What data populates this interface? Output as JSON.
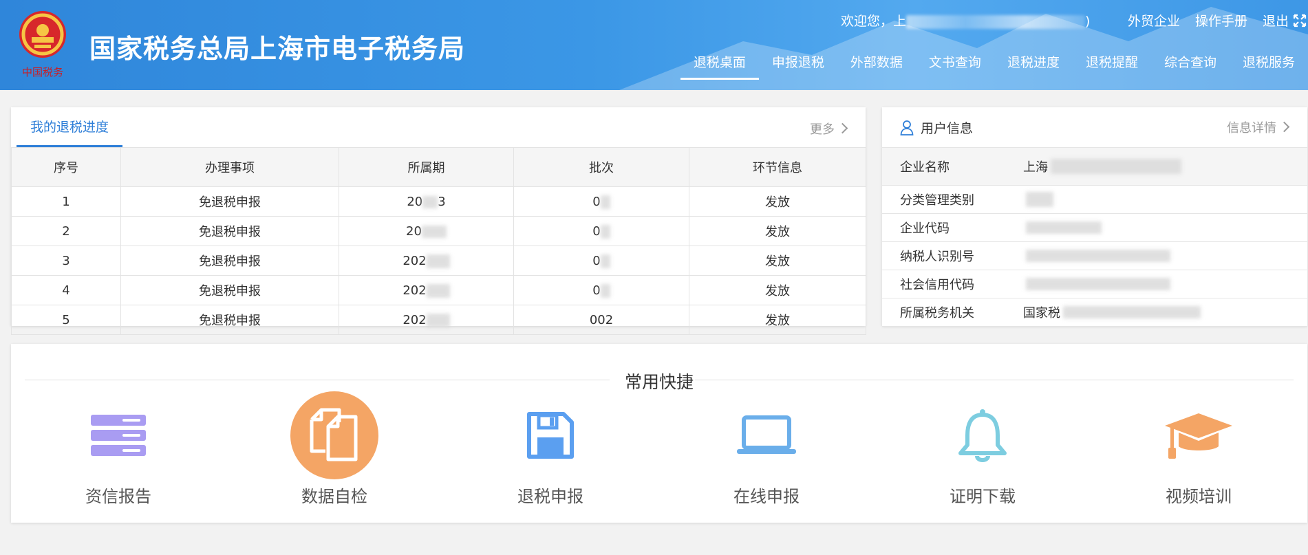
{
  "header": {
    "site_title": "国家税务总局上海市电子税务局",
    "welcome_prefix": "欢迎您，上",
    "welcome_suffix": ")",
    "links": [
      "外贸企业",
      "操作手册",
      "退出"
    ],
    "nav": [
      "退税桌面",
      "申报退税",
      "外部数据",
      "文书查询",
      "退税进度",
      "退税提醒",
      "综合查询",
      "退税服务"
    ],
    "active_nav": "退税桌面",
    "emblem_caption": "中国税务"
  },
  "progress": {
    "tab_title": "我的退税进度",
    "more": "更多",
    "columns": [
      "序号",
      "办理事项",
      "所属期",
      "批次",
      "环节信息"
    ],
    "rows": [
      {
        "no": "1",
        "item": "免退税申报",
        "period": "20",
        "period_tail": "3",
        "batch": "0",
        "status": "发放"
      },
      {
        "no": "2",
        "item": "免退税申报",
        "period": "20",
        "period_tail": "",
        "batch": "0",
        "status": "发放"
      },
      {
        "no": "3",
        "item": "免退税申报",
        "period": "202",
        "period_tail": "",
        "batch": "0",
        "status": "发放"
      },
      {
        "no": "4",
        "item": "免退税申报",
        "period": "202",
        "period_tail": "",
        "batch": "0",
        "status": "发放"
      },
      {
        "no": "5",
        "item": "免退税申报",
        "period": "202",
        "period_tail": "",
        "batch": "002",
        "status": "发放"
      }
    ]
  },
  "user_info": {
    "title": "用户信息",
    "more": "信息详情",
    "rows": [
      {
        "label": "企业名称",
        "value": "上海"
      },
      {
        "label": "分类管理类别",
        "value": ""
      },
      {
        "label": "企业代码",
        "value": ""
      },
      {
        "label": "纳税人识别号",
        "value": ""
      },
      {
        "label": "社会信用代码",
        "value": ""
      },
      {
        "label": "所属税务机关",
        "value": "国家税"
      }
    ]
  },
  "quick": {
    "title": "常用快捷",
    "items": [
      {
        "label": "资信报告",
        "icon": "server-icon",
        "color": "#a99cf2"
      },
      {
        "label": "数据自检",
        "icon": "copy-documents-icon",
        "color": "#f4a565"
      },
      {
        "label": "退税申报",
        "icon": "floppy-disk-icon",
        "color": "#5b9ff0"
      },
      {
        "label": "在线申报",
        "icon": "laptop-icon",
        "color": "#6aaeea"
      },
      {
        "label": "证明下载",
        "icon": "bell-icon",
        "color": "#7dcde0"
      },
      {
        "label": "视频培训",
        "icon": "graduation-cap-icon",
        "color": "#f4a565"
      }
    ]
  }
}
